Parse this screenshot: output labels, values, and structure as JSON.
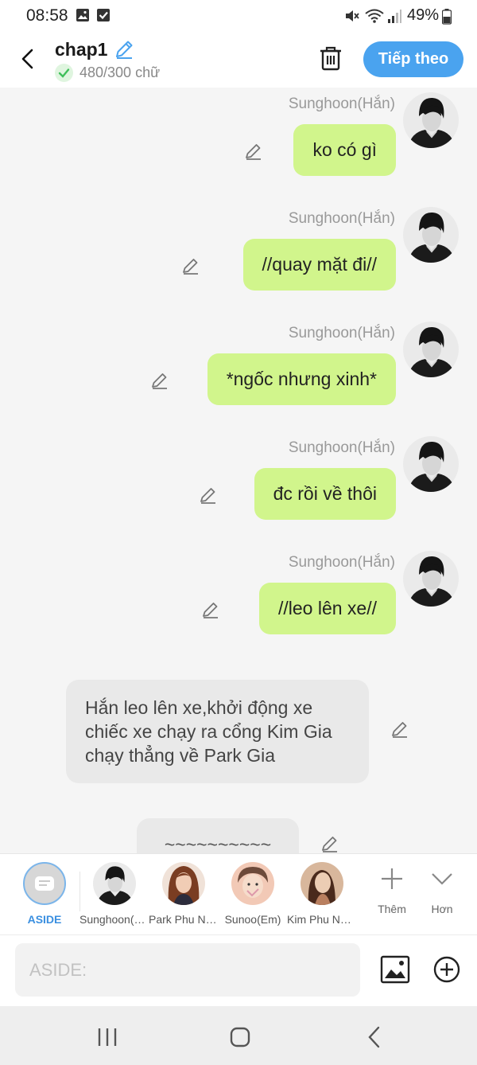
{
  "status_bar": {
    "time": "08:58",
    "battery": "49%",
    "left_icons": [
      "image-icon",
      "check-box-icon"
    ],
    "right_icons": [
      "mute-icon",
      "wifi-icon",
      "signal-icon",
      "battery-icon"
    ]
  },
  "header": {
    "title": "chap1",
    "word_count": "480/300 chữ",
    "next_label": "Tiếp theo",
    "accent_color": "#4aa3ef"
  },
  "messages": [
    {
      "speaker": "Sunghoon(Hắn)",
      "text": "ko có gì"
    },
    {
      "speaker": "Sunghoon(Hắn)",
      "text": "//quay mặt đi//"
    },
    {
      "speaker": "Sunghoon(Hắn)",
      "text": "*ngốc nhưng xinh*"
    },
    {
      "speaker": "Sunghoon(Hắn)",
      "text": "đc rồi về thôi"
    },
    {
      "speaker": "Sunghoon(Hắn)",
      "text": "//leo lên xe//"
    }
  ],
  "aside_messages": [
    {
      "text": "Hắn leo lên xe,khởi động xe chiếc xe chạy ra cổng Kim Gia chạy thẳng về Park Gia"
    },
    {
      "text": "~~~~~~~~~~"
    }
  ],
  "characters": [
    {
      "label": "ASIDE",
      "active": true
    },
    {
      "label": "Sunghoon(Hắn)",
      "active": false
    },
    {
      "label": "Park Phu Nhân",
      "active": false
    },
    {
      "label": "Sunoo(Em)",
      "active": false
    },
    {
      "label": "Kim Phu Nhân",
      "active": false
    }
  ],
  "char_actions": {
    "add_label": "Thêm",
    "more_label": "Hơn"
  },
  "input": {
    "placeholder": "ASIDE:",
    "value": ""
  },
  "bubble_color": "#d1f58c"
}
